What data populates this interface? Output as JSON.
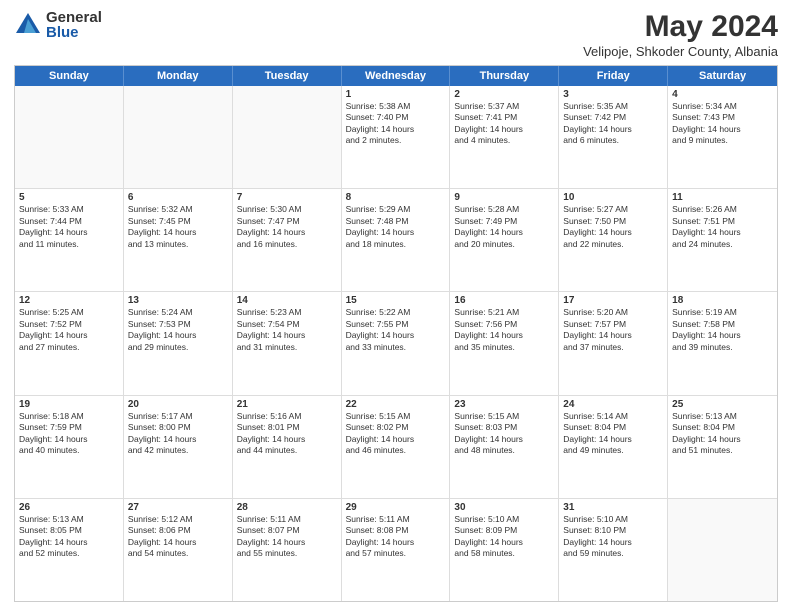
{
  "logo": {
    "general": "General",
    "blue": "Blue"
  },
  "title": "May 2024",
  "subtitle": "Velipoje, Shkoder County, Albania",
  "headers": [
    "Sunday",
    "Monday",
    "Tuesday",
    "Wednesday",
    "Thursday",
    "Friday",
    "Saturday"
  ],
  "rows": [
    [
      {
        "day": "",
        "lines": [],
        "empty": true
      },
      {
        "day": "",
        "lines": [],
        "empty": true
      },
      {
        "day": "",
        "lines": [],
        "empty": true
      },
      {
        "day": "1",
        "lines": [
          "Sunrise: 5:38 AM",
          "Sunset: 7:40 PM",
          "Daylight: 14 hours",
          "and 2 minutes."
        ]
      },
      {
        "day": "2",
        "lines": [
          "Sunrise: 5:37 AM",
          "Sunset: 7:41 PM",
          "Daylight: 14 hours",
          "and 4 minutes."
        ]
      },
      {
        "day": "3",
        "lines": [
          "Sunrise: 5:35 AM",
          "Sunset: 7:42 PM",
          "Daylight: 14 hours",
          "and 6 minutes."
        ]
      },
      {
        "day": "4",
        "lines": [
          "Sunrise: 5:34 AM",
          "Sunset: 7:43 PM",
          "Daylight: 14 hours",
          "and 9 minutes."
        ]
      }
    ],
    [
      {
        "day": "5",
        "lines": [
          "Sunrise: 5:33 AM",
          "Sunset: 7:44 PM",
          "Daylight: 14 hours",
          "and 11 minutes."
        ]
      },
      {
        "day": "6",
        "lines": [
          "Sunrise: 5:32 AM",
          "Sunset: 7:45 PM",
          "Daylight: 14 hours",
          "and 13 minutes."
        ]
      },
      {
        "day": "7",
        "lines": [
          "Sunrise: 5:30 AM",
          "Sunset: 7:47 PM",
          "Daylight: 14 hours",
          "and 16 minutes."
        ]
      },
      {
        "day": "8",
        "lines": [
          "Sunrise: 5:29 AM",
          "Sunset: 7:48 PM",
          "Daylight: 14 hours",
          "and 18 minutes."
        ]
      },
      {
        "day": "9",
        "lines": [
          "Sunrise: 5:28 AM",
          "Sunset: 7:49 PM",
          "Daylight: 14 hours",
          "and 20 minutes."
        ]
      },
      {
        "day": "10",
        "lines": [
          "Sunrise: 5:27 AM",
          "Sunset: 7:50 PM",
          "Daylight: 14 hours",
          "and 22 minutes."
        ]
      },
      {
        "day": "11",
        "lines": [
          "Sunrise: 5:26 AM",
          "Sunset: 7:51 PM",
          "Daylight: 14 hours",
          "and 24 minutes."
        ]
      }
    ],
    [
      {
        "day": "12",
        "lines": [
          "Sunrise: 5:25 AM",
          "Sunset: 7:52 PM",
          "Daylight: 14 hours",
          "and 27 minutes."
        ]
      },
      {
        "day": "13",
        "lines": [
          "Sunrise: 5:24 AM",
          "Sunset: 7:53 PM",
          "Daylight: 14 hours",
          "and 29 minutes."
        ]
      },
      {
        "day": "14",
        "lines": [
          "Sunrise: 5:23 AM",
          "Sunset: 7:54 PM",
          "Daylight: 14 hours",
          "and 31 minutes."
        ]
      },
      {
        "day": "15",
        "lines": [
          "Sunrise: 5:22 AM",
          "Sunset: 7:55 PM",
          "Daylight: 14 hours",
          "and 33 minutes."
        ]
      },
      {
        "day": "16",
        "lines": [
          "Sunrise: 5:21 AM",
          "Sunset: 7:56 PM",
          "Daylight: 14 hours",
          "and 35 minutes."
        ]
      },
      {
        "day": "17",
        "lines": [
          "Sunrise: 5:20 AM",
          "Sunset: 7:57 PM",
          "Daylight: 14 hours",
          "and 37 minutes."
        ]
      },
      {
        "day": "18",
        "lines": [
          "Sunrise: 5:19 AM",
          "Sunset: 7:58 PM",
          "Daylight: 14 hours",
          "and 39 minutes."
        ]
      }
    ],
    [
      {
        "day": "19",
        "lines": [
          "Sunrise: 5:18 AM",
          "Sunset: 7:59 PM",
          "Daylight: 14 hours",
          "and 40 minutes."
        ]
      },
      {
        "day": "20",
        "lines": [
          "Sunrise: 5:17 AM",
          "Sunset: 8:00 PM",
          "Daylight: 14 hours",
          "and 42 minutes."
        ]
      },
      {
        "day": "21",
        "lines": [
          "Sunrise: 5:16 AM",
          "Sunset: 8:01 PM",
          "Daylight: 14 hours",
          "and 44 minutes."
        ]
      },
      {
        "day": "22",
        "lines": [
          "Sunrise: 5:15 AM",
          "Sunset: 8:02 PM",
          "Daylight: 14 hours",
          "and 46 minutes."
        ]
      },
      {
        "day": "23",
        "lines": [
          "Sunrise: 5:15 AM",
          "Sunset: 8:03 PM",
          "Daylight: 14 hours",
          "and 48 minutes."
        ]
      },
      {
        "day": "24",
        "lines": [
          "Sunrise: 5:14 AM",
          "Sunset: 8:04 PM",
          "Daylight: 14 hours",
          "and 49 minutes."
        ]
      },
      {
        "day": "25",
        "lines": [
          "Sunrise: 5:13 AM",
          "Sunset: 8:04 PM",
          "Daylight: 14 hours",
          "and 51 minutes."
        ]
      }
    ],
    [
      {
        "day": "26",
        "lines": [
          "Sunrise: 5:13 AM",
          "Sunset: 8:05 PM",
          "Daylight: 14 hours",
          "and 52 minutes."
        ]
      },
      {
        "day": "27",
        "lines": [
          "Sunrise: 5:12 AM",
          "Sunset: 8:06 PM",
          "Daylight: 14 hours",
          "and 54 minutes."
        ]
      },
      {
        "day": "28",
        "lines": [
          "Sunrise: 5:11 AM",
          "Sunset: 8:07 PM",
          "Daylight: 14 hours",
          "and 55 minutes."
        ]
      },
      {
        "day": "29",
        "lines": [
          "Sunrise: 5:11 AM",
          "Sunset: 8:08 PM",
          "Daylight: 14 hours",
          "and 57 minutes."
        ]
      },
      {
        "day": "30",
        "lines": [
          "Sunrise: 5:10 AM",
          "Sunset: 8:09 PM",
          "Daylight: 14 hours",
          "and 58 minutes."
        ]
      },
      {
        "day": "31",
        "lines": [
          "Sunrise: 5:10 AM",
          "Sunset: 8:10 PM",
          "Daylight: 14 hours",
          "and 59 minutes."
        ]
      },
      {
        "day": "",
        "lines": [],
        "empty": true
      }
    ]
  ]
}
